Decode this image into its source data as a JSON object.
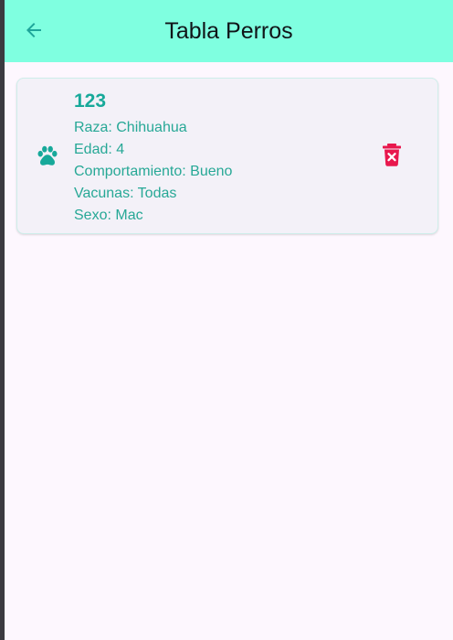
{
  "window": {
    "background": "#3b3a40",
    "screen_background": "#fdf7fe"
  },
  "appbar": {
    "title": "Tabla Perros",
    "background": "#7fffe0",
    "back_icon": "arrow-left-icon",
    "back_icon_color": "#1ea59a"
  },
  "dogs": [
    {
      "name": "123",
      "breed": "Raza: Chihuahua",
      "age": "Edad: 4",
      "behavior": "Comportamiento: Bueno",
      "vaccines": "Vacunas: Todas",
      "sex": "Sexo: Mac",
      "leading_icon": "paw-icon",
      "trailing_icon": "trash-delete-icon"
    }
  ],
  "colors": {
    "accent": "#17a99a",
    "detail_text": "#27a896",
    "delete": "#e8184d",
    "card_background": "#f3f1f8",
    "card_border": "#cfeeea"
  }
}
